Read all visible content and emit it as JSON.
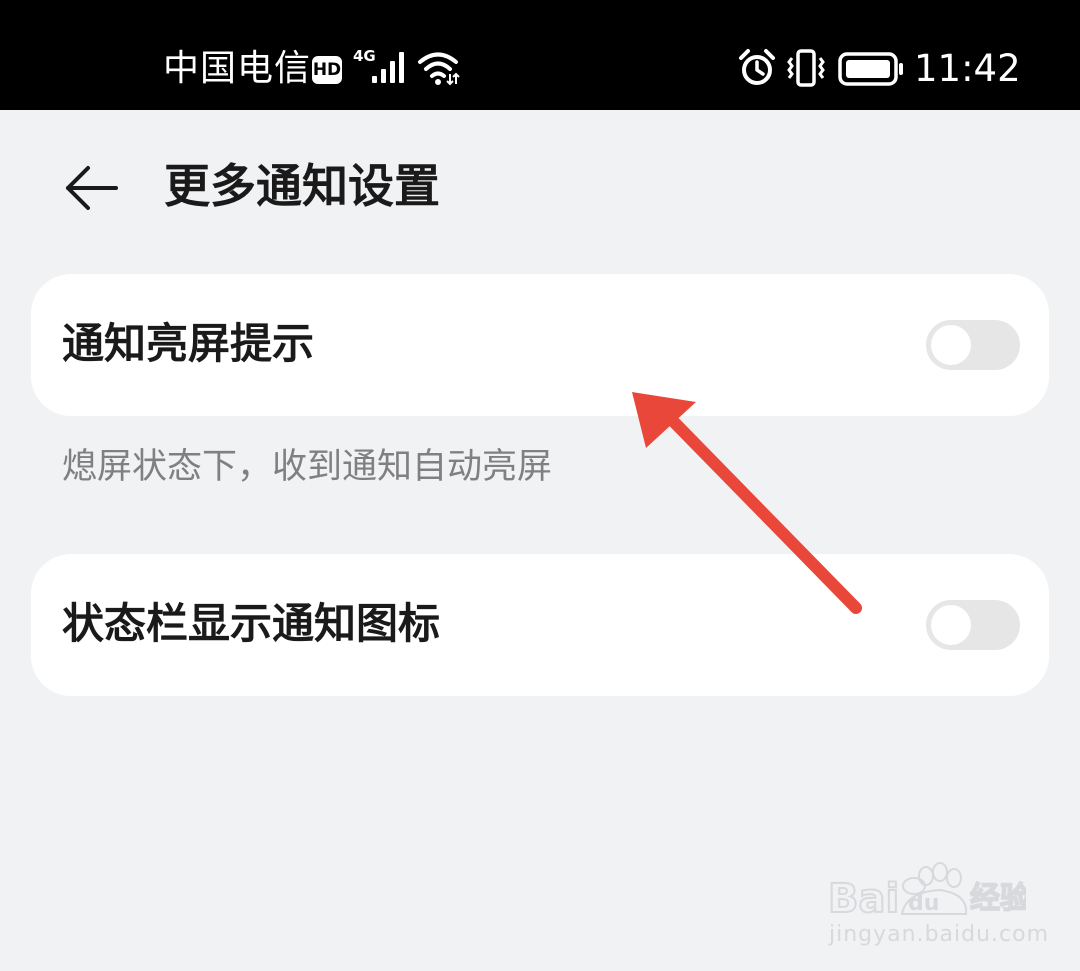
{
  "status_bar": {
    "carrier": "中国电信",
    "hd_badge": "HD",
    "network_type": "4G",
    "time": "11:42",
    "icons": [
      "hd-icon",
      "signal-icon",
      "wifi-icon",
      "alarm-icon",
      "vibrate-icon",
      "battery-icon"
    ]
  },
  "header": {
    "back_icon": "arrow-left-icon",
    "title": "更多通知设置"
  },
  "settings": [
    {
      "label": "通知亮屏提示",
      "enabled": false,
      "description": "熄屏状态下，收到通知自动亮屏"
    },
    {
      "label": "状态栏显示通知图标",
      "enabled": false
    }
  ],
  "annotation": {
    "color": "#e8473a",
    "icon": "red-arrow"
  },
  "watermark": {
    "brand": "Baidu经验",
    "url": "jingyan.baidu.com"
  },
  "colors": {
    "status_bar": "#000000",
    "background": "#f1f2f4",
    "card": "#ffffff",
    "toggle_off": "#e6e6e6",
    "annotation": "#e8473a"
  }
}
